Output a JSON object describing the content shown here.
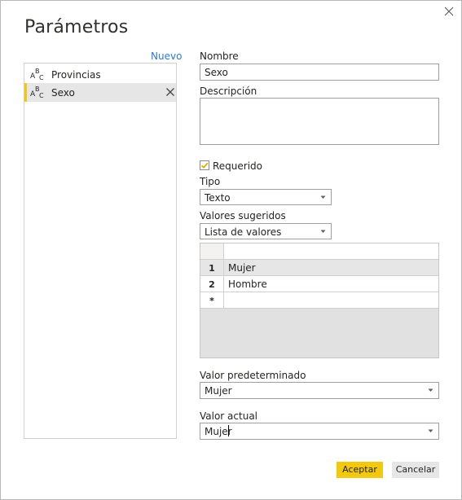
{
  "dialog": {
    "title": "Parámetros",
    "close_icon": "close-icon"
  },
  "list": {
    "new_label": "Nuevo",
    "items": [
      {
        "label": "Provincias",
        "icon": "text-type-icon",
        "selected": false
      },
      {
        "label": "Sexo",
        "icon": "text-type-icon",
        "selected": true
      }
    ]
  },
  "form": {
    "name_label": "Nombre",
    "name_value": "Sexo",
    "description_label": "Descripción",
    "description_value": "",
    "required_label": "Requerido",
    "required_checked": true,
    "type_label": "Tipo",
    "type_value": "Texto",
    "suggested_label": "Valores sugeridos",
    "suggested_value": "Lista de valores",
    "values_table": {
      "rows": [
        {
          "num": "1",
          "value": "Mujer"
        },
        {
          "num": "2",
          "value": "Hombre"
        },
        {
          "num": "*",
          "value": ""
        }
      ]
    },
    "default_label": "Valor predeterminado",
    "default_value": "Mujer",
    "current_label": "Valor actual",
    "current_value": "Mujer"
  },
  "buttons": {
    "accept": "Aceptar",
    "cancel": "Cancelar"
  },
  "colors": {
    "accent": "#f2c811",
    "link": "#2b79d0",
    "selected_bg": "#e6e6e6"
  }
}
